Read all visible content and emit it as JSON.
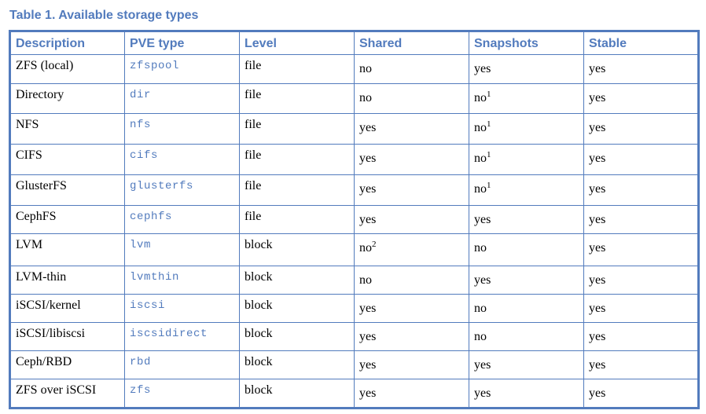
{
  "caption": "Table 1. Available storage types",
  "headers": [
    "Description",
    "PVE type",
    "Level",
    "Shared",
    "Snapshots",
    "Stable"
  ],
  "rows": [
    {
      "desc": "ZFS (local)",
      "type": "zfspool",
      "level": "file",
      "shared": "no",
      "shared_note": "",
      "snap": "yes",
      "snap_note": "",
      "stable": "yes"
    },
    {
      "desc": "Directory",
      "type": "dir",
      "level": "file",
      "shared": "no",
      "shared_note": "",
      "snap": "no",
      "snap_note": "1",
      "stable": "yes"
    },
    {
      "desc": "NFS",
      "type": "nfs",
      "level": "file",
      "shared": "yes",
      "shared_note": "",
      "snap": "no",
      "snap_note": "1",
      "stable": "yes"
    },
    {
      "desc": "CIFS",
      "type": "cifs",
      "level": "file",
      "shared": "yes",
      "shared_note": "",
      "snap": "no",
      "snap_note": "1",
      "stable": "yes"
    },
    {
      "desc": "GlusterFS",
      "type": "glusterfs",
      "level": "file",
      "shared": "yes",
      "shared_note": "",
      "snap": "no",
      "snap_note": "1",
      "stable": "yes"
    },
    {
      "desc": "CephFS",
      "type": "cephfs",
      "level": "file",
      "shared": "yes",
      "shared_note": "",
      "snap": "yes",
      "snap_note": "",
      "stable": "yes"
    },
    {
      "desc": "LVM",
      "type": "lvm",
      "level": "block",
      "shared": "no",
      "shared_note": "2",
      "snap": "no",
      "snap_note": "",
      "stable": "yes"
    },
    {
      "desc": "LVM-thin",
      "type": "lvmthin",
      "level": "block",
      "shared": "no",
      "shared_note": "",
      "snap": "yes",
      "snap_note": "",
      "stable": "yes"
    },
    {
      "desc": "iSCSI/kernel",
      "type": "iscsi",
      "level": "block",
      "shared": "yes",
      "shared_note": "",
      "snap": "no",
      "snap_note": "",
      "stable": "yes"
    },
    {
      "desc": "iSCSI/libiscsi",
      "type": "iscsidirect",
      "level": "block",
      "shared": "yes",
      "shared_note": "",
      "snap": "no",
      "snap_note": "",
      "stable": "yes"
    },
    {
      "desc": "Ceph/RBD",
      "type": "rbd",
      "level": "block",
      "shared": "yes",
      "shared_note": "",
      "snap": "yes",
      "snap_note": "",
      "stable": "yes"
    },
    {
      "desc": "ZFS over iSCSI",
      "type": "zfs",
      "level": "block",
      "shared": "yes",
      "shared_note": "",
      "snap": "yes",
      "snap_note": "",
      "stable": "yes"
    }
  ],
  "colors": {
    "accent": "#527bbd",
    "text": "#000000",
    "background": "#ffffff"
  }
}
